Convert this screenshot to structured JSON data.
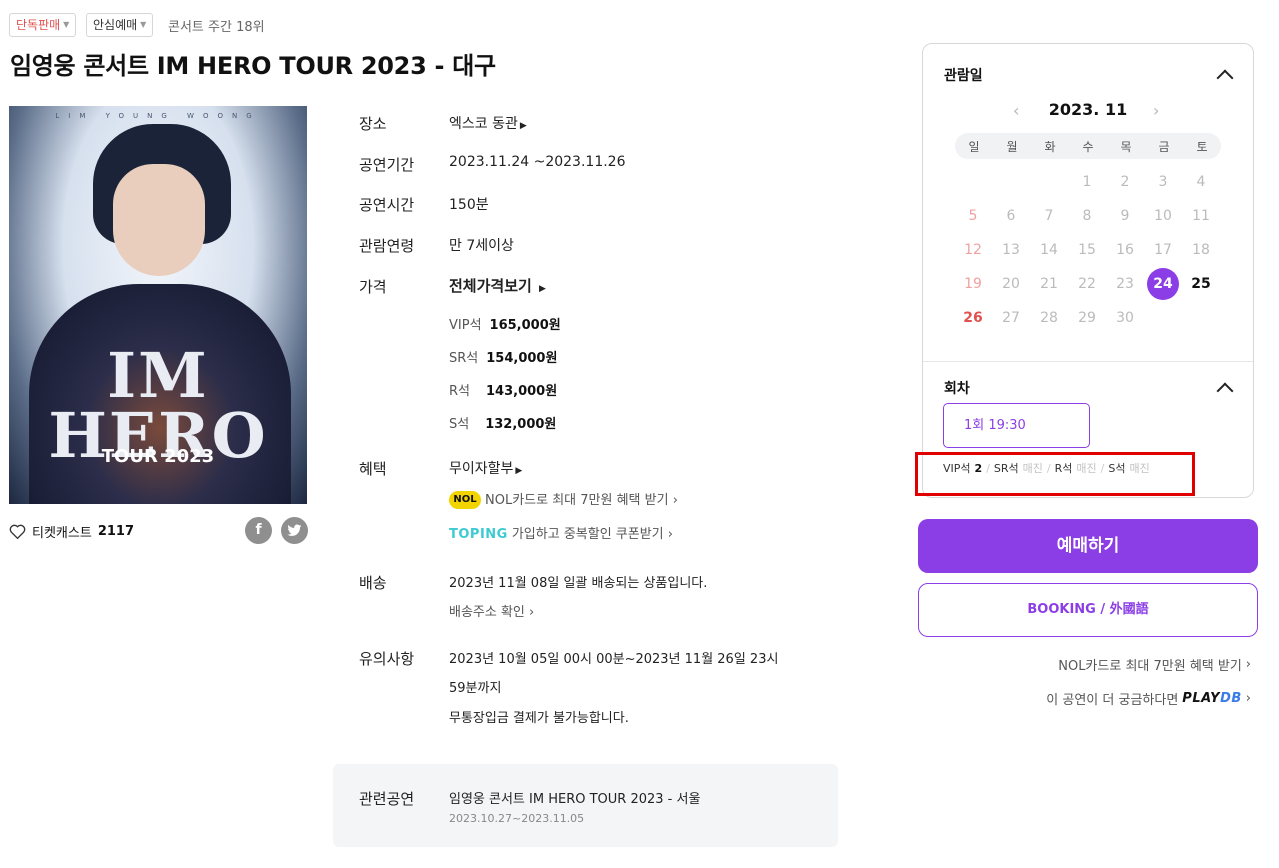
{
  "badges": [
    {
      "label": "단독판매",
      "color": "#e0524f"
    },
    {
      "label": "안심예매",
      "color": "#333333"
    }
  ],
  "rank": "콘서트 주간 18위",
  "title": "임영웅 콘서트 IM HERO TOUR 2023 - 대구",
  "poster": {
    "artist_text": "LIM YOUNG WOONG",
    "logo_text": [
      "IM",
      "HERO"
    ],
    "tour_text": "TOUR 2023"
  },
  "likes": {
    "label": "티켓캐스트",
    "count": "2117"
  },
  "share": {
    "facebook": "f",
    "twitter": "t"
  },
  "info": {
    "venue": {
      "label": "장소",
      "value": "엑스코 동관"
    },
    "period": {
      "label": "공연기간",
      "value": "2023.11.24 ~2023.11.26"
    },
    "runtime": {
      "label": "공연시간",
      "value": "150분"
    },
    "age": {
      "label": "관람연령",
      "value": "만 7세이상"
    },
    "price": {
      "label": "가격",
      "link": "전체가격보기",
      "rows": [
        {
          "grade": "VIP석",
          "price": "165,000원"
        },
        {
          "grade": "SR석",
          "price": "154,000원"
        },
        {
          "grade": "R석",
          "price": "143,000원"
        },
        {
          "grade": "S석",
          "price": "132,000원"
        }
      ]
    },
    "benefit": {
      "label": "혜택",
      "installment": "무이자할부",
      "nol_logo": "NOL",
      "nol_text": "NOL카드로 최대 7만원 혜택 받기",
      "toping_logo": "TOPING",
      "toping_text": "가입하고 중복할인 쿠폰받기"
    },
    "delivery": {
      "label": "배송",
      "text": "2023년 11월 08일 일괄 배송되는 상품입니다.",
      "link": "배송주소 확인"
    },
    "notice": {
      "label": "유의사항",
      "line1": "2023년 10월 05일 00시 00분~2023년 11월 26일 23시",
      "line2": "59분까지",
      "line3": "무통장입금 결제가 불가능합니다."
    },
    "related": {
      "label": "관련공연",
      "title": "임영웅 콘서트 IM HERO TOUR 2023 - 서울",
      "dates": "2023.10.27~2023.11.05"
    }
  },
  "booking": {
    "date_section": "관람일",
    "month": "2023. 11",
    "prev": "‹",
    "next": "›",
    "weekdays": [
      "일",
      "월",
      "화",
      "수",
      "목",
      "금",
      "토"
    ],
    "days": [
      {
        "d": "1",
        "col": 3,
        "row": 0,
        "state": "disabled"
      },
      {
        "d": "2",
        "col": 4,
        "row": 0,
        "state": "disabled"
      },
      {
        "d": "3",
        "col": 5,
        "row": 0,
        "state": "disabled"
      },
      {
        "d": "4",
        "col": 6,
        "row": 0,
        "state": "disabled"
      },
      {
        "d": "5",
        "col": 0,
        "row": 1,
        "state": "disabled"
      },
      {
        "d": "6",
        "col": 1,
        "row": 1,
        "state": "disabled"
      },
      {
        "d": "7",
        "col": 2,
        "row": 1,
        "state": "disabled"
      },
      {
        "d": "8",
        "col": 3,
        "row": 1,
        "state": "disabled"
      },
      {
        "d": "9",
        "col": 4,
        "row": 1,
        "state": "disabled"
      },
      {
        "d": "10",
        "col": 5,
        "row": 1,
        "state": "disabled"
      },
      {
        "d": "11",
        "col": 6,
        "row": 1,
        "state": "disabled"
      },
      {
        "d": "12",
        "col": 0,
        "row": 2,
        "state": "disabled"
      },
      {
        "d": "13",
        "col": 1,
        "row": 2,
        "state": "disabled"
      },
      {
        "d": "14",
        "col": 2,
        "row": 2,
        "state": "disabled"
      },
      {
        "d": "15",
        "col": 3,
        "row": 2,
        "state": "disabled"
      },
      {
        "d": "16",
        "col": 4,
        "row": 2,
        "state": "disabled"
      },
      {
        "d": "17",
        "col": 5,
        "row": 2,
        "state": "disabled"
      },
      {
        "d": "18",
        "col": 6,
        "row": 2,
        "state": "disabled"
      },
      {
        "d": "19",
        "col": 0,
        "row": 3,
        "state": "disabled"
      },
      {
        "d": "20",
        "col": 1,
        "row": 3,
        "state": "disabled"
      },
      {
        "d": "21",
        "col": 2,
        "row": 3,
        "state": "disabled"
      },
      {
        "d": "22",
        "col": 3,
        "row": 3,
        "state": "disabled"
      },
      {
        "d": "23",
        "col": 4,
        "row": 3,
        "state": "disabled"
      },
      {
        "d": "24",
        "col": 5,
        "row": 3,
        "state": "selected"
      },
      {
        "d": "25",
        "col": 6,
        "row": 3,
        "state": "active"
      },
      {
        "d": "26",
        "col": 0,
        "row": 4,
        "state": "active"
      },
      {
        "d": "27",
        "col": 1,
        "row": 4,
        "state": "disabled"
      },
      {
        "d": "28",
        "col": 2,
        "row": 4,
        "state": "disabled"
      },
      {
        "d": "29",
        "col": 3,
        "row": 4,
        "state": "disabled"
      },
      {
        "d": "30",
        "col": 4,
        "row": 4,
        "state": "disabled"
      }
    ],
    "round_section": "회차",
    "round_label": "1회 19:30",
    "seats": [
      {
        "grade": "VIP석",
        "status": "2"
      },
      {
        "grade": "SR석",
        "status": "매진"
      },
      {
        "grade": "R석",
        "status": "매진"
      },
      {
        "grade": "S석",
        "status": "매진"
      }
    ],
    "book_button": "예매하기",
    "foreign_button": "BOOKING / 外國語",
    "nol_link": "NOL카드로 최대 7만원 혜택 받기",
    "playdb_link": "이 공연이 더 궁금하다면",
    "playdb_logo": [
      "PLAY",
      "DB"
    ]
  },
  "colors": {
    "accent": "#8b3ee6",
    "highlight_box": "#e00000",
    "sunday": "#e0524f"
  }
}
